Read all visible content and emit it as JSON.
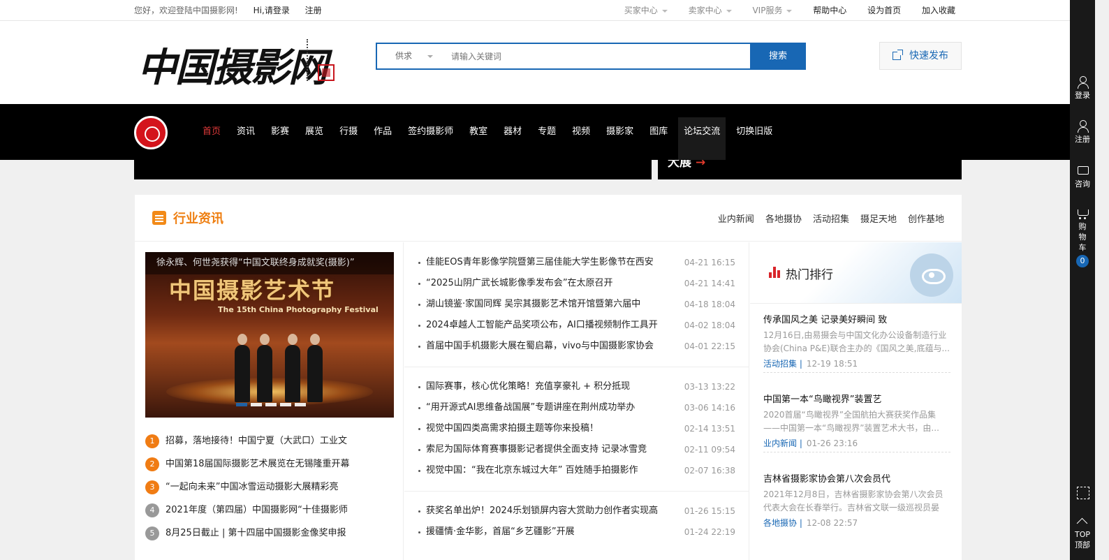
{
  "topbar": {
    "welcome": "您好，欢迎登陆中国摄影网!",
    "login": "Hi,请登录",
    "register": "注册",
    "buyer_center": "买家中心",
    "seller_center": "卖家中心",
    "vip": "VIP服务",
    "help": "帮助中心",
    "set_home": "设为首页",
    "bookmark": "加入收藏"
  },
  "header": {
    "logo_text": "中国摄影网",
    "search_category": "供求",
    "search_placeholder": "请输入关键词",
    "search_button": "搜索",
    "quick_publish": "快速发布"
  },
  "nav": {
    "items": [
      {
        "label": "首页",
        "active": true
      },
      {
        "label": "资讯"
      },
      {
        "label": "影赛"
      },
      {
        "label": "展览"
      },
      {
        "label": "行摄"
      },
      {
        "label": "作品"
      },
      {
        "label": "签约摄影师"
      },
      {
        "label": "教室"
      },
      {
        "label": "器材"
      },
      {
        "label": "专题"
      },
      {
        "label": "视频"
      },
      {
        "label": "摄影家"
      },
      {
        "label": "图库"
      },
      {
        "label": "论坛交流",
        "hover": true
      },
      {
        "label": "切换旧版"
      }
    ]
  },
  "banner": {
    "right_text": "大展",
    "arrow": "→"
  },
  "news": {
    "title": "行业资讯",
    "tabs": [
      "业内新闻",
      "各地摄协",
      "活动招集",
      "摄足天地",
      "创作基地"
    ],
    "featured": {
      "caption": "徐永辉、何世尧获得“中国文联终身成就奖(摄影)”",
      "image_title": "中国摄影艺术节",
      "image_subtitle": "The 15th China Photography Festival"
    },
    "ranked": [
      {
        "num": "1",
        "text": "招募，落地接待！中国宁夏（大武口）工业文"
      },
      {
        "num": "2",
        "text": "中国第18届国际摄影艺术展览在无锡隆重开幕"
      },
      {
        "num": "3",
        "text": "“一起向未来”中国冰雪运动摄影大展精彩亮"
      },
      {
        "num": "4",
        "text": "2021年度（第四届）中国摄影网“十佳摄影师"
      },
      {
        "num": "5",
        "text": "8月25日截止 | 第十四届中国摄影金像奖申报"
      }
    ],
    "groups": [
      [
        {
          "text": "佳能EOS青年影像学院暨第三届佳能大学生影像节在西安",
          "date": "04-21 16:15"
        },
        {
          "text": "“2025山阴广武长城影像季发布会”在太原召开",
          "date": "04-21 14:41"
        },
        {
          "text": "湖山镜鉴·家国同辉 吴宗其摄影艺术馆开馆暨第六届中",
          "date": "04-18 18:04"
        },
        {
          "text": "2024卓越人工智能产品奖项公布，AI口播视频制作工具开",
          "date": "04-02 18:04"
        },
        {
          "text": "首届中国手机摄影大展在蜀启幕，vivo与中国摄影家协会",
          "date": "04-01 22:15"
        }
      ],
      [
        {
          "text": "国际赛事，核心优化策略！充值享豪礼 + 积分抵现",
          "date": "03-13 13:22"
        },
        {
          "text": "“用开源式AI思维备战国展”专题讲座在荆州成功举办",
          "date": "03-06 14:16"
        },
        {
          "text": "视觉中国四类高需求拍摄主题等你来投稿！",
          "date": "02-14 13:51"
        },
        {
          "text": "索尼为国际体育赛事摄影记者提供全面支持 记录冰雪竞",
          "date": "02-11 09:54"
        },
        {
          "text": "视觉中国：“我在北京东城过大年” 百姓随手拍摄影作",
          "date": "02-07 16:38"
        }
      ],
      [
        {
          "text": "获奖名单出炉！2024乐划锁屏内容大赏助力创作者实现高",
          "date": "01-26 15:15"
        },
        {
          "text": "援疆情·金华影，首届“乡艺疆影”开展",
          "date": "01-24 22:19"
        }
      ]
    ],
    "hot": {
      "title": "热门排行",
      "articles": [
        {
          "title": "传承国风之美 记录美好瞬间 致",
          "desc": "12月16日,由易摄会与中国文化办公设备制造行业协会(China P&E)联合主办的《国风之美,底蕴与...",
          "tag": "活动招集 |",
          "date": "12-19 18:51"
        },
        {
          "title": "中国第一本“鸟瞰视界”装置艺",
          "desc": "2020首届“鸟瞰视界”全国航拍大赛获奖作品集——中国第一本“鸟瞰视界”装置艺术大书，由...",
          "tag": "业内新闻 |",
          "date": "01-26 23:16"
        },
        {
          "title": "吉林省摄影家协会第八次会员代",
          "desc": "2021年12月8日，吉林省摄影家协会第八次会员代表大会在长春举行。吉林省文联一级巡视员晏喜...",
          "tag": "各地摄协 |",
          "date": "12-08 22:57"
        }
      ]
    }
  },
  "sidebar": {
    "login": "登录",
    "register": "注册",
    "consult": "咨询",
    "cart": [
      "购",
      "物",
      "车"
    ],
    "cart_count": "0",
    "top": "TOP",
    "top_cn": "顶部"
  }
}
